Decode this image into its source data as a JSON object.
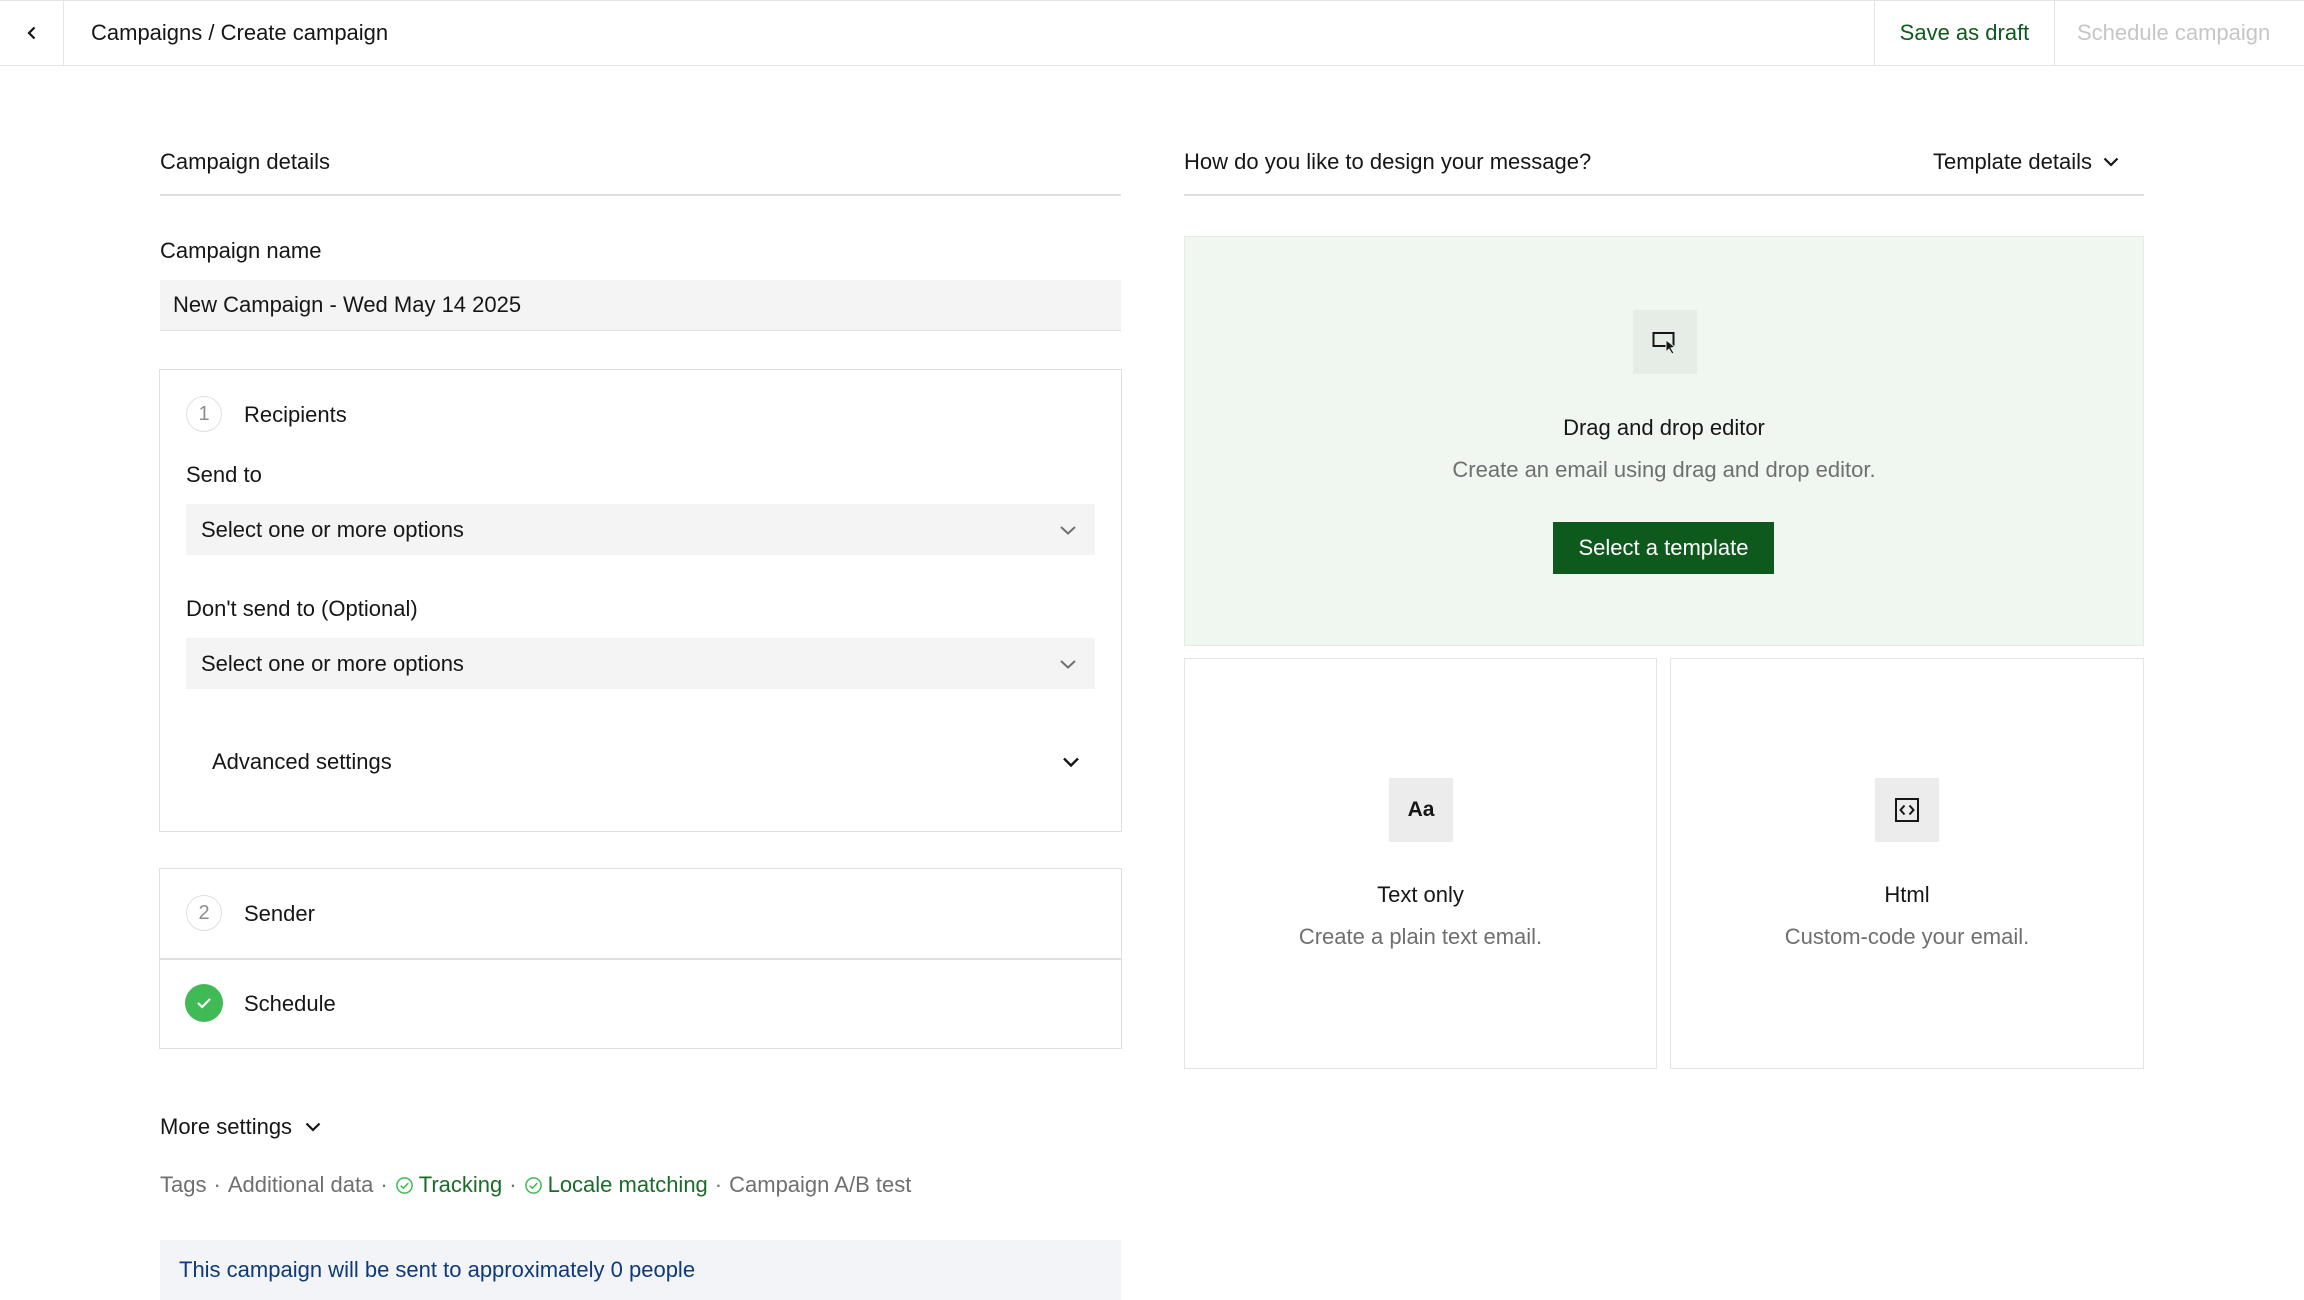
{
  "header": {
    "breadcrumb": "Campaigns / Create campaign",
    "save_draft_label": "Save as draft",
    "schedule_label": "Schedule campaign"
  },
  "campaign_details": {
    "heading": "Campaign details",
    "name_label": "Campaign name",
    "name_value": "New Campaign - Wed May 14 2025"
  },
  "recipients": {
    "step_number": "1",
    "title": "Recipients",
    "send_to_label": "Send to",
    "send_to_placeholder": "Select one or more options",
    "dont_send_label": "Don't send to (Optional)",
    "dont_send_placeholder": "Select one or more options",
    "advanced_label": "Advanced settings"
  },
  "sender": {
    "step_number": "2",
    "title": "Sender"
  },
  "schedule": {
    "title": "Schedule",
    "completed": true
  },
  "more_settings": {
    "label": "More settings",
    "items": [
      {
        "label": "Tags",
        "enabled": false
      },
      {
        "label": "Additional data",
        "enabled": false
      },
      {
        "label": "Tracking",
        "enabled": true
      },
      {
        "label": "Locale matching",
        "enabled": true
      },
      {
        "label": "Campaign A/B test",
        "enabled": false
      }
    ]
  },
  "notice": "This campaign will be sent to approximately 0 people",
  "design": {
    "heading": "How do you like to design your message?",
    "template_details_label": "Template details",
    "drag_drop": {
      "title": "Drag and drop editor",
      "description": "Create an email using drag and drop editor.",
      "button_label": "Select a template",
      "icon": "cursor-select-icon"
    },
    "text_only": {
      "title": "Text only",
      "description": "Create a plain text email.",
      "icon_text": "Aa"
    },
    "html": {
      "title": "Html",
      "description": "Custom-code your email.",
      "icon": "code-icon"
    }
  },
  "colors": {
    "accent_green": "#0e5a1c",
    "check_green": "#3fba54",
    "panel_green": "#f0f7f0",
    "notice_text": "#0f3a78"
  }
}
